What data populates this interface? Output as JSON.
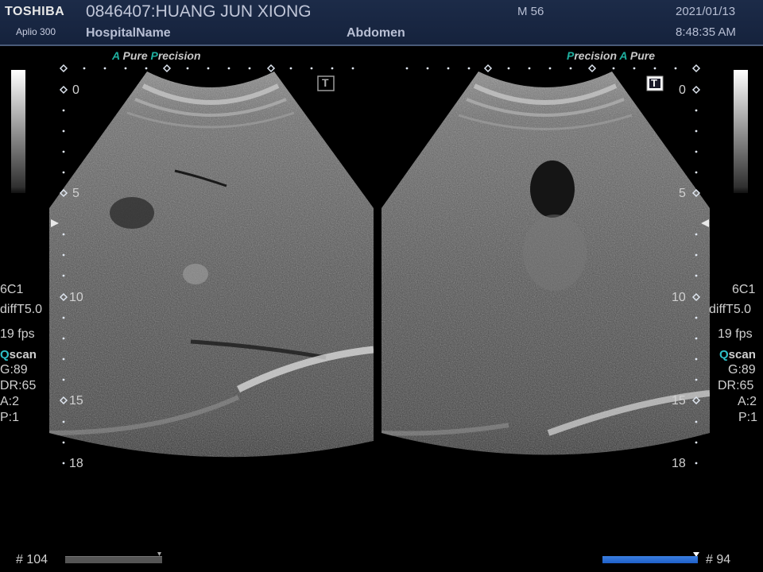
{
  "header": {
    "brand": "TOSHIBA",
    "model": "Aplio 300",
    "patient": "0846407:HUANG JUN XIONG",
    "hospital": "HospitalName",
    "exam": "Abdomen",
    "mi": "M 56",
    "date": "2021/01/13",
    "time": "8:48:35 AM"
  },
  "left": {
    "pp_a1": "A",
    "pp_w1": " Pure ",
    "pp_a2": "P",
    "pp_w2": "recision",
    "depth": [
      "0",
      "5",
      "10",
      "15",
      "18"
    ],
    "probe": "6C1",
    "mode": "diffT5.0",
    "fps": "19 fps",
    "q": "Q",
    "scan": "scan",
    "gain": "G:89",
    "dr": "DR:65",
    "a": "A:2",
    "p": "P:1",
    "frame": "# 104"
  },
  "right": {
    "pp_a1": "P",
    "pp_w1": "recision  ",
    "pp_a2": "A",
    "pp_w2": " Pure",
    "depth": [
      "0",
      "5",
      "10",
      "15",
      "18"
    ],
    "probe": "6C1",
    "mode": "diffT5.0",
    "fps": "19 fps",
    "q": "Q",
    "scan": "scan",
    "gain": "G:89",
    "dr": "DR:65",
    "a": "A:2",
    "p": "P:1",
    "frame": "# 94"
  },
  "icons": {
    "left_body_marker": "T",
    "right_body_marker": "T"
  },
  "progress": {
    "left_fraction": 1.0,
    "right_fraction": 1.0
  },
  "colors": {
    "accent": "#1fb0a0",
    "header_bg": "#1c2b48",
    "progress_right": "#1e5fc8",
    "progress_left": "#555555"
  }
}
